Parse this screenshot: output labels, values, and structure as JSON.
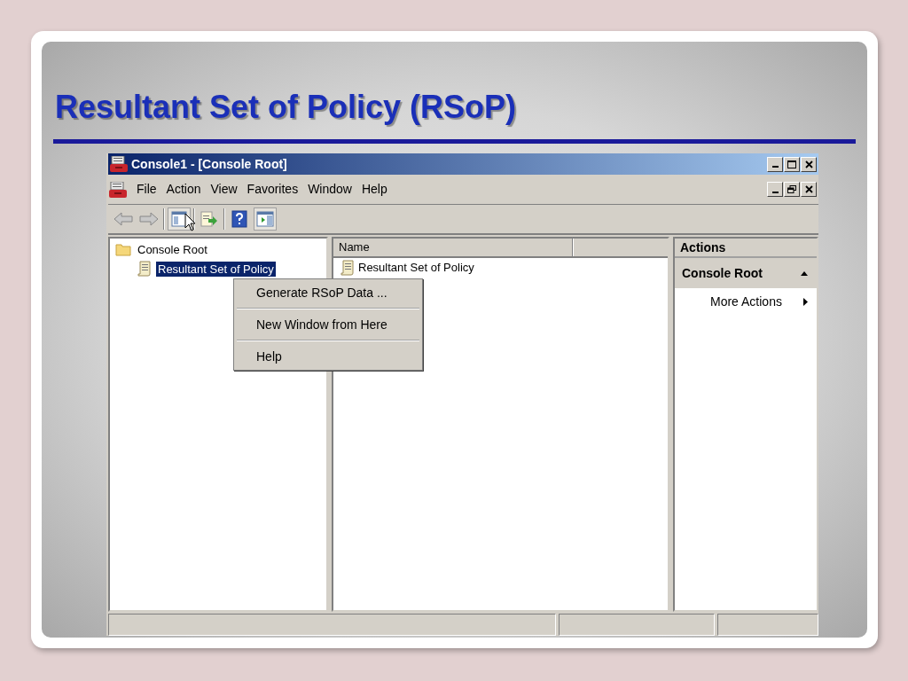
{
  "slide": {
    "title": "Resultant Set of Policy (RSoP)"
  },
  "window": {
    "title": "Console1 - [Console Root]"
  },
  "menu": [
    "File",
    "Action",
    "View",
    "Favorites",
    "Window",
    "Help"
  ],
  "toolbar": [
    {
      "kind": "back",
      "pressed": false
    },
    {
      "kind": "forward",
      "pressed": false
    },
    {
      "kind": "tree",
      "pressed": true
    },
    {
      "kind": "export",
      "pressed": false
    },
    {
      "kind": "help",
      "pressed": false
    },
    {
      "kind": "actionpane",
      "pressed": true
    }
  ],
  "tree": [
    {
      "label": "Console Root",
      "kind": "folder",
      "selected": false,
      "children": [
        {
          "label": "Resultant Set of Policy",
          "kind": "policy",
          "selected": true
        }
      ]
    }
  ],
  "list": {
    "columns": [
      "Name"
    ],
    "rows": [
      "Resultant Set of Policy"
    ]
  },
  "context_menu": [
    "Generate RSoP Data ...",
    "New Window from Here",
    "Help"
  ],
  "actions": {
    "title": "Actions",
    "section": "Console Root",
    "expanded": true,
    "items": [
      "More Actions"
    ]
  }
}
